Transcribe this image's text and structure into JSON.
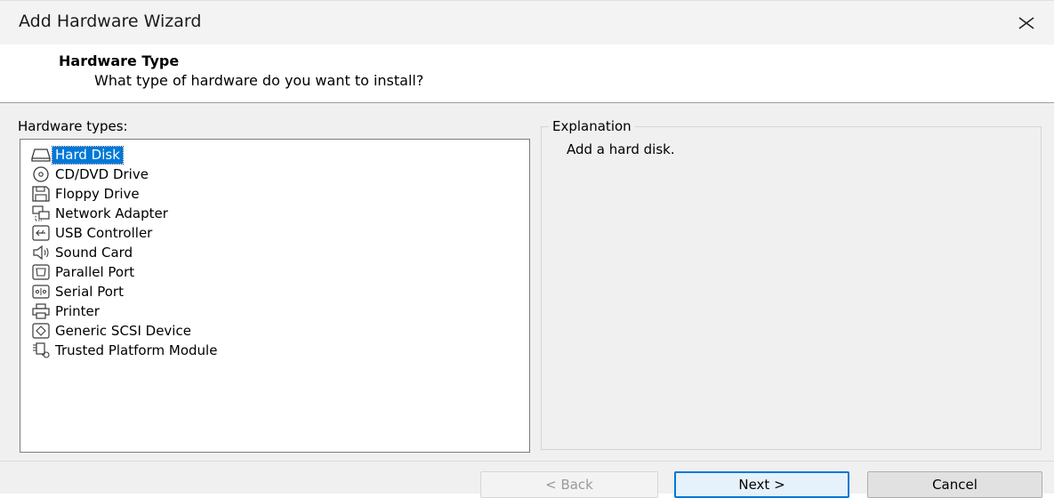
{
  "window": {
    "title": "Add Hardware Wizard"
  },
  "header": {
    "heading": "Hardware Type",
    "subheading": "What type of hardware do you want to install?"
  },
  "hardware_types": {
    "label": "Hardware types:",
    "selected_index": 0,
    "items": [
      {
        "label": "Hard Disk",
        "icon": "hard-disk-icon"
      },
      {
        "label": "CD/DVD Drive",
        "icon": "cd-dvd-icon"
      },
      {
        "label": "Floppy Drive",
        "icon": "floppy-icon"
      },
      {
        "label": "Network Adapter",
        "icon": "network-adapter-icon"
      },
      {
        "label": "USB Controller",
        "icon": "usb-icon"
      },
      {
        "label": "Sound Card",
        "icon": "sound-card-icon"
      },
      {
        "label": "Parallel Port",
        "icon": "parallel-port-icon"
      },
      {
        "label": "Serial Port",
        "icon": "serial-port-icon"
      },
      {
        "label": "Printer",
        "icon": "printer-icon"
      },
      {
        "label": "Generic SCSI Device",
        "icon": "scsi-device-icon"
      },
      {
        "label": "Trusted Platform Module",
        "icon": "tpm-icon"
      }
    ]
  },
  "explanation": {
    "label": "Explanation",
    "text": "Add a hard disk."
  },
  "buttons": {
    "back": "< Back",
    "next": "Next >",
    "cancel": "Cancel"
  },
  "colors": {
    "selection": "#0078d7",
    "default_button_border": "#0078d7"
  }
}
